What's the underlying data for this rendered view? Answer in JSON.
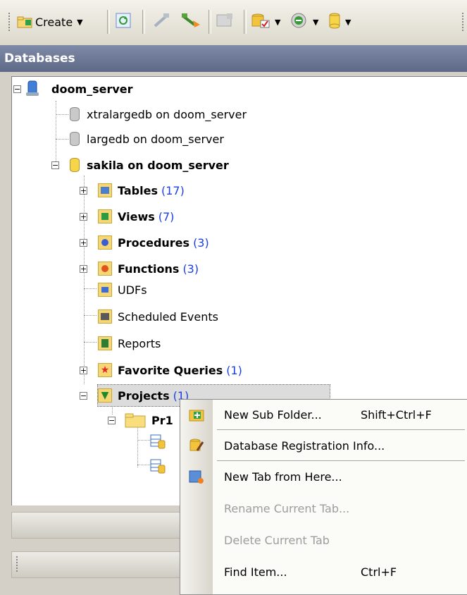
{
  "toolbar": {
    "create_label": "Create"
  },
  "panel": {
    "title": "Databases"
  },
  "tree": {
    "server": "doom_server",
    "db1": "xtralargedb on doom_server",
    "db2": "largedb on doom_server",
    "db3": "sakila on doom_server",
    "tables": {
      "label": "Tables",
      "count": "(17)"
    },
    "views": {
      "label": "Views",
      "count": "(7)"
    },
    "procedures": {
      "label": "Procedures",
      "count": "(3)"
    },
    "functions": {
      "label": "Functions",
      "count": "(3)"
    },
    "udfs": "UDFs",
    "events": "Scheduled Events",
    "reports": "Reports",
    "favorites": {
      "label": "Favorite Queries",
      "count": "(1)"
    },
    "projects": {
      "label": "Projects",
      "count": "(1)"
    },
    "pr1": "Pr1"
  },
  "menu": {
    "items": [
      {
        "label": "New Sub Folder...",
        "shortcut": "Shift+Ctrl+F",
        "enabled": true
      },
      {
        "label": "Database Registration Info...",
        "shortcut": "",
        "enabled": true
      },
      {
        "label": "New Tab from Here...",
        "shortcut": "",
        "enabled": true
      },
      {
        "label": "Rename Current Tab...",
        "shortcut": "",
        "enabled": false
      },
      {
        "label": "Delete Current Tab",
        "shortcut": "",
        "enabled": false
      },
      {
        "label": "Find Item...",
        "shortcut": "Ctrl+F",
        "enabled": true
      }
    ]
  },
  "colors": {
    "header": "#6b7694",
    "count_blue": "#1a3ee8",
    "menu_bg": "#fbfbf8"
  }
}
